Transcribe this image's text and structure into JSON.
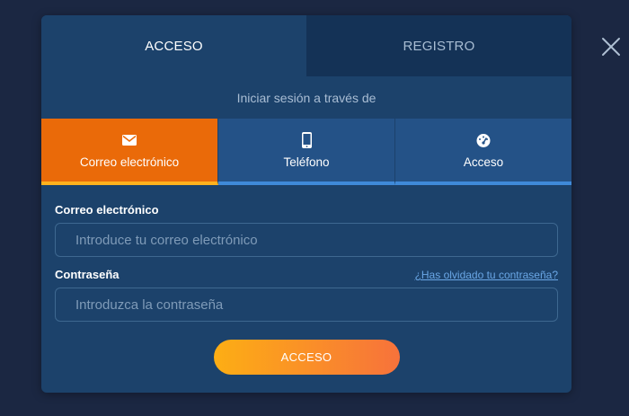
{
  "header_tabs": [
    {
      "label": "ACCESO",
      "active": true
    },
    {
      "label": "REGISTRO",
      "active": false
    }
  ],
  "subtitle": "Iniciar sesión a través de",
  "methods": [
    {
      "label": "Correo electrónico",
      "icon": "envelope-icon",
      "active": true
    },
    {
      "label": "Teléfono",
      "icon": "phone-icon",
      "active": false
    },
    {
      "label": "Acceso",
      "icon": "gauge-icon",
      "active": false
    }
  ],
  "form": {
    "email_label": "Correo electrónico",
    "email_placeholder": "Introduce tu correo electrónico",
    "password_label": "Contraseña",
    "password_placeholder": "Introduzca la contraseña",
    "forgot_link": "¿Has olvidado tu contraseña?",
    "submit_label": "ACCESO"
  },
  "colors": {
    "page_bg": "#1b2742",
    "modal_bg": "#1c426b",
    "active_method": "#ea6a09",
    "inactive_method": "#245287",
    "link": "#6aa7e6"
  }
}
